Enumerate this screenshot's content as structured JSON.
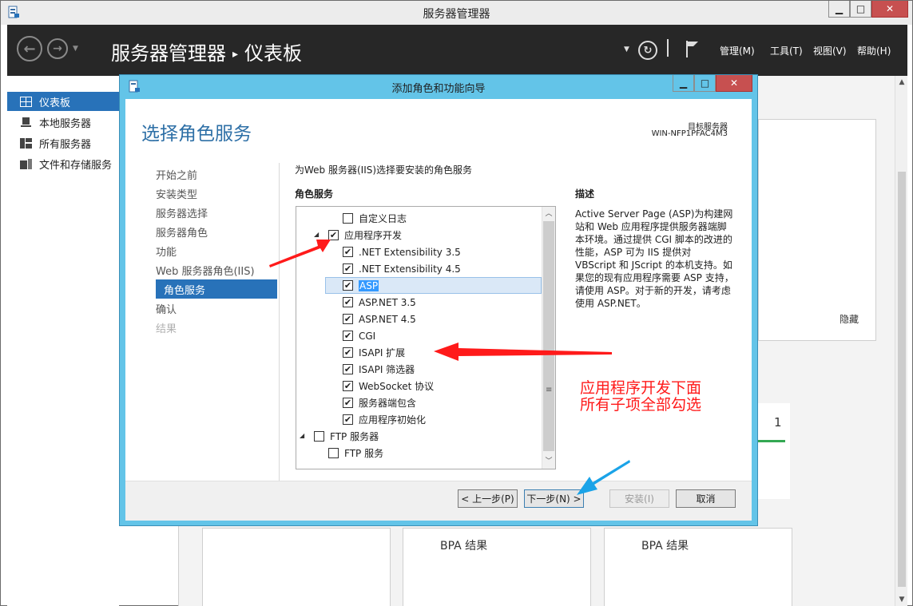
{
  "window": {
    "title": "服务器管理器"
  },
  "header": {
    "title": "服务器管理器",
    "breadcrumb_sep": "▸",
    "page": "仪表板",
    "menus": [
      "管理(M)",
      "工具(T)",
      "视图(V)",
      "帮助(H)"
    ]
  },
  "sidebar": {
    "items": [
      {
        "label": "仪表板",
        "icon": "dashboard-icon",
        "active": true
      },
      {
        "label": "本地服务器",
        "icon": "server-icon",
        "active": false
      },
      {
        "label": "所有服务器",
        "icon": "servers-icon",
        "active": false
      },
      {
        "label": "文件和存储服务",
        "icon": "storage-icon",
        "active": false
      }
    ]
  },
  "background": {
    "hide_label": "隐藏",
    "count": "1",
    "bpa_label": "BPA 结果"
  },
  "wizard": {
    "title": "添加角色和功能向导",
    "heading": "选择角色服务",
    "target_label": "目标服务器",
    "target_name": "WIN-NFP1PFAC4M3",
    "steps": [
      {
        "label": "开始之前",
        "state": "normal"
      },
      {
        "label": "安装类型",
        "state": "normal"
      },
      {
        "label": "服务器选择",
        "state": "normal"
      },
      {
        "label": "服务器角色",
        "state": "normal"
      },
      {
        "label": "功能",
        "state": "normal"
      },
      {
        "label": "Web 服务器角色(IIS)",
        "state": "normal"
      },
      {
        "label": "角色服务",
        "state": "current"
      },
      {
        "label": "确认",
        "state": "normal"
      },
      {
        "label": "结果",
        "state": "disabled"
      }
    ],
    "instruction": "为Web 服务器(IIS)选择要安装的角色服务",
    "roles_heading": "角色服务",
    "description_heading": "描述",
    "description": "Active Server Page (ASP)为构建网站和 Web 应用程序提供服务器端脚本环境。通过提供 CGI 脚本的改进的性能，ASP 可为 IIS 提供对 VBScript 和 JScript 的本机支持。如果您的现有应用程序需要 ASP 支持，请使用 ASP。对于新的开发，请考虑使用 ASP.NET。",
    "tree": [
      {
        "label": "自定义日志",
        "checked": false,
        "indent": 2,
        "expander": ""
      },
      {
        "label": "应用程序开发",
        "checked": true,
        "indent": 1,
        "expander": "◢"
      },
      {
        "label": ".NET Extensibility 3.5",
        "checked": true,
        "indent": 2,
        "expander": ""
      },
      {
        "label": ".NET Extensibility 4.5",
        "checked": true,
        "indent": 2,
        "expander": ""
      },
      {
        "label": "ASP",
        "checked": true,
        "indent": 2,
        "expander": "",
        "selected": true
      },
      {
        "label": "ASP.NET 3.5",
        "checked": true,
        "indent": 2,
        "expander": ""
      },
      {
        "label": "ASP.NET 4.5",
        "checked": true,
        "indent": 2,
        "expander": ""
      },
      {
        "label": "CGI",
        "checked": true,
        "indent": 2,
        "expander": ""
      },
      {
        "label": "ISAPI 扩展",
        "checked": true,
        "indent": 2,
        "expander": ""
      },
      {
        "label": "ISAPI 筛选器",
        "checked": true,
        "indent": 2,
        "expander": ""
      },
      {
        "label": "WebSocket 协议",
        "checked": true,
        "indent": 2,
        "expander": ""
      },
      {
        "label": "服务器端包含",
        "checked": true,
        "indent": 2,
        "expander": ""
      },
      {
        "label": "应用程序初始化",
        "checked": true,
        "indent": 2,
        "expander": ""
      },
      {
        "label": "FTP 服务器",
        "checked": false,
        "indent": 0,
        "expander": "◢"
      },
      {
        "label": "FTP 服务",
        "checked": false,
        "indent": 1,
        "expander": ""
      }
    ],
    "buttons": {
      "prev": "< 上一步(P)",
      "next": "下一步(N) >",
      "install": "安装(I)",
      "cancel": "取消"
    }
  },
  "annotation": {
    "text": "应用程序开发下面所有子项全部勾选",
    "color": "#ff1a1a",
    "arrow_blue": "#1aa3e8"
  }
}
